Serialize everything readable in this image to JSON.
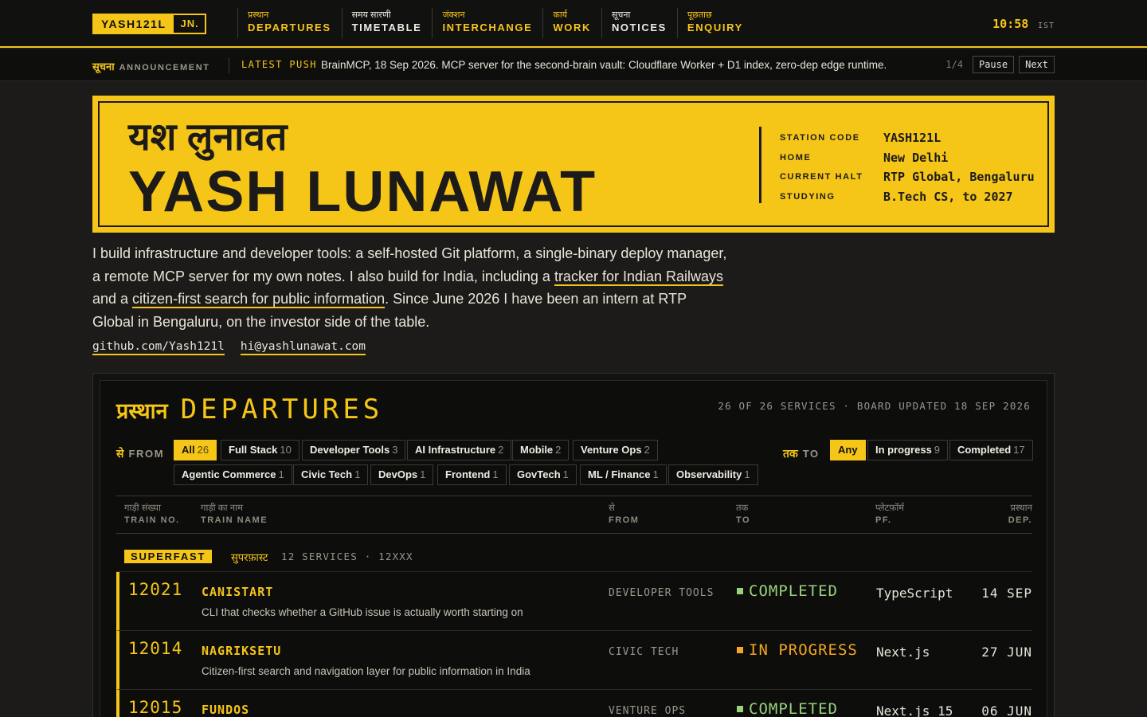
{
  "brand": {
    "name": "YASH121L",
    "suffix": "JN."
  },
  "nav": [
    {
      "hi": "प्रस्थान",
      "en": "DEPARTURES"
    },
    {
      "hi": "समय सारणी",
      "en": "TIMETABLE"
    },
    {
      "hi": "जंक्शन",
      "en": "INTERCHANGE"
    },
    {
      "hi": "कार्य",
      "en": "WORK"
    },
    {
      "hi": "सूचना",
      "en": "NOTICES"
    },
    {
      "hi": "पूछताछ",
      "en": "ENQUIRY"
    }
  ],
  "clock": {
    "time": "10:58",
    "zone": "IST"
  },
  "announcement": {
    "label_hi": "सूचना",
    "label_en": "ANNOUNCEMENT",
    "tag": "LATEST PUSH",
    "text": "BrainMCP, 18 Sep 2026. MCP server for the second-brain vault: Cloudflare Worker + D1 index, zero-dep edge runtime.",
    "counter": "1/4",
    "pause_label": "Pause",
    "next_label": "Next"
  },
  "hero": {
    "name_hi": "यश लुनावत",
    "name_en": "YASH LUNAWAT",
    "meta": [
      {
        "k": "STATION CODE",
        "v": "YASH121L"
      },
      {
        "k": "HOME",
        "v": "New Delhi"
      },
      {
        "k": "CURRENT HALT",
        "v": "RTP Global, Bengaluru"
      },
      {
        "k": "STUDYING",
        "v": "B.Tech CS, to 2027"
      }
    ]
  },
  "bio": {
    "p1": "I build infrastructure and developer tools: a self-hosted Git platform, a single-binary deploy manager, a remote MCP server for my own notes. I also build for India, including a ",
    "link1": "tracker for Indian Railways",
    "p2": " and a ",
    "link2": "citizen-first search for public information",
    "p3": ". Since June 2026 I have been an intern at RTP Global in Bengaluru, on the investor side of the table."
  },
  "links": {
    "github": "github.com/Yash121l",
    "email": "hi@yashlunawat.com"
  },
  "board": {
    "title_hi": "प्रस्थान",
    "title_en": "DEPARTURES",
    "status": "26 OF 26 SERVICES · BOARD UPDATED 18 SEP 2026",
    "from_hi": "से",
    "from_en": "FROM",
    "to_hi": "तक",
    "to_en": "TO",
    "from_filters": [
      {
        "label": "All",
        "count": "26"
      },
      {
        "label": "Full Stack",
        "count": "10"
      },
      {
        "label": "Developer Tools",
        "count": "3"
      },
      {
        "label": "AI Infrastructure",
        "count": "2"
      },
      {
        "label": "Mobile",
        "count": "2"
      },
      {
        "label": "Venture Ops",
        "count": "2"
      },
      {
        "label": "Agentic Commerce",
        "count": "1"
      },
      {
        "label": "Civic Tech",
        "count": "1"
      },
      {
        "label": "DevOps",
        "count": "1"
      },
      {
        "label": "Frontend",
        "count": "1"
      },
      {
        "label": "GovTech",
        "count": "1"
      },
      {
        "label": "ML / Finance",
        "count": "1"
      },
      {
        "label": "Observability",
        "count": "1"
      }
    ],
    "to_filters": [
      {
        "label": "Any",
        "count": ""
      },
      {
        "label": "In progress",
        "count": "9"
      },
      {
        "label": "Completed",
        "count": "17"
      }
    ],
    "columns": [
      {
        "hi": "गाड़ी संख्या",
        "en": "TRAIN NO."
      },
      {
        "hi": "गाड़ी का नाम",
        "en": "TRAIN NAME"
      },
      {
        "hi": "से",
        "en": "FROM"
      },
      {
        "hi": "तक",
        "en": "TO"
      },
      {
        "hi": "प्लेटफ़ॉर्म",
        "en": "PF."
      },
      {
        "hi": "प्रस्थान",
        "en": "DEP."
      }
    ],
    "section": {
      "badge": "SUPERFAST",
      "hi": "सुपरफ़ास्ट",
      "meta": "12 SERVICES · 12XXX"
    },
    "rows": [
      {
        "no": "12021",
        "name": "CANISTART",
        "desc": "CLI that checks whether a GitHub issue is actually worth starting on",
        "from": "DEVELOPER TOOLS",
        "status": "COMPLETED",
        "pf": "TypeScript",
        "dep": "14 SEP"
      },
      {
        "no": "12014",
        "name": "NAGRIKSETU",
        "desc": "Citizen-first search and navigation layer for public information in India",
        "from": "CIVIC TECH",
        "status": "IN PROGRESS",
        "pf": "Next.js",
        "dep": "27 JUN"
      },
      {
        "no": "12015",
        "name": "FUNDOS",
        "desc": "",
        "from": "VENTURE OPS",
        "status": "COMPLETED",
        "pf": "Next.js 15",
        "dep": "06 JUN"
      }
    ]
  },
  "colors": {
    "accent": "#f5c518",
    "completed": "#9ad27a",
    "in_progress": "#f5a623",
    "background": "#1c1b19"
  }
}
